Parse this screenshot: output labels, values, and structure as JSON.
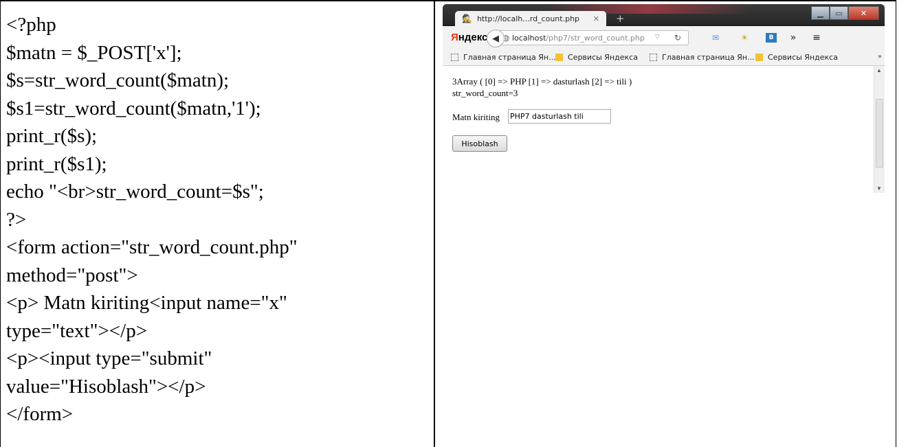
{
  "code_lines": [
    "<?php",
    "$matn = $_POST['x'];",
    "$s=str_word_count($matn);",
    "$s1=str_word_count($matn,'1');",
    "print_r($s);",
    "print_r($s1);",
    "echo \"<br>str_word_count=$s\";",
    "?>",
    "<form action=\"str_word_count.php\"",
    "method=\"post\">",
    "<p> Matn kiriting<input name=\"x\"",
    "type=\"text\"></p>",
    "<p><input type=\"submit\"",
    "value=\"Hisoblash\"></p>",
    "</form>"
  ],
  "browser": {
    "tab_title": "http://localh...rd_count.php",
    "brand": {
      "first_letter": "Я",
      "rest": "ндекс"
    },
    "url": {
      "host": "localhost",
      "path": "/php7/str_word_count.php"
    },
    "bookmarks": [
      {
        "label": "Главная страница Ян...",
        "icon": "page-icon"
      },
      {
        "label": "Сервисы Яндекса",
        "icon": "folder-icon"
      },
      {
        "label": "Главная страница Ян...",
        "icon": "page-icon"
      },
      {
        "label": "Сервисы Яндекса",
        "icon": "folder-icon"
      }
    ],
    "output_line1": "3Array ( [0] => PHP [1] => dasturlash [2] => tili )",
    "output_line2": "str_word_count=3",
    "input_label": "Matn kiriting",
    "input_value": "PHP7 dasturlash tili",
    "submit_label": "Hisoblash"
  }
}
